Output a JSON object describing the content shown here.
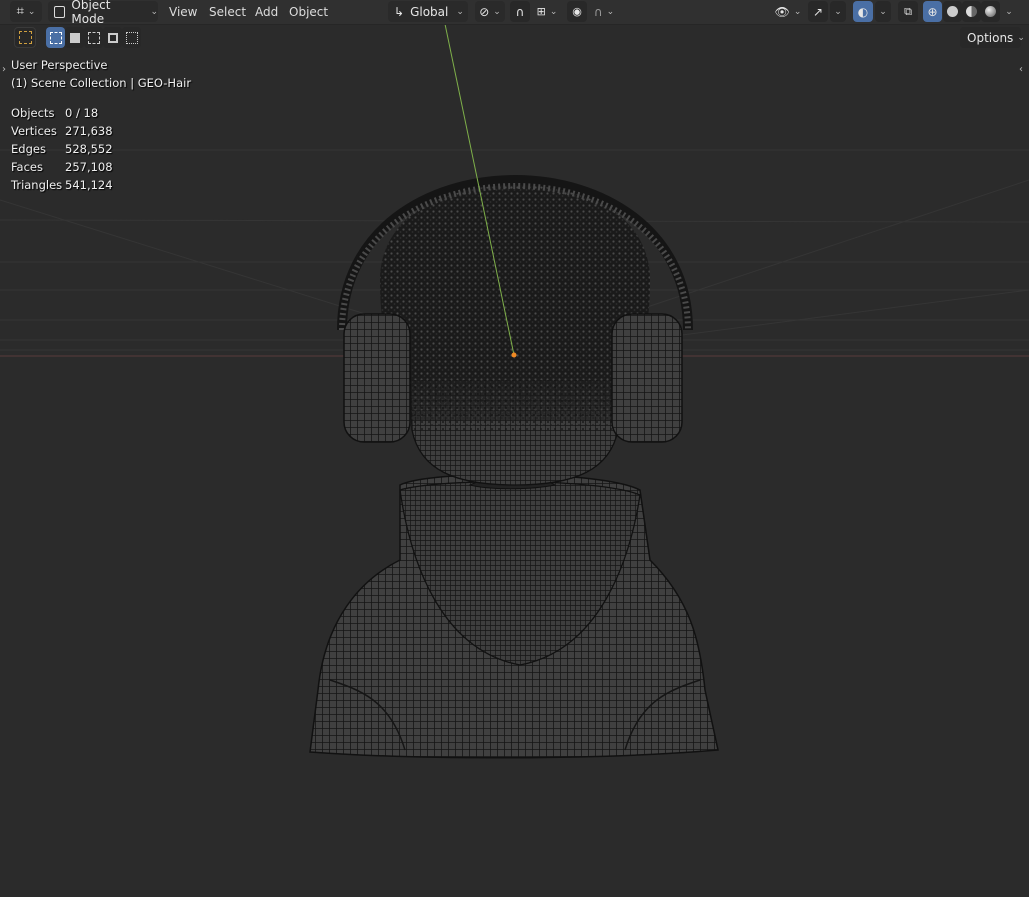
{
  "header": {
    "editor_type_icon": "transform-axes-icon",
    "mode_label": "Object Mode",
    "menus": [
      "View",
      "Select",
      "Add",
      "Object"
    ],
    "orientation_label": "Global",
    "options_label": "Options"
  },
  "overlay": {
    "view_name": "User Perspective",
    "collection": "(1) Scene Collection | GEO-Hair"
  },
  "stats": [
    {
      "label": "Objects",
      "value": "0 / 18"
    },
    {
      "label": "Vertices",
      "value": "271,638"
    },
    {
      "label": "Edges",
      "value": "528,552"
    },
    {
      "label": "Faces",
      "value": "257,108"
    },
    {
      "label": "Triangles",
      "value": "541,124"
    }
  ],
  "colors": {
    "header_bg": "#303030",
    "viewport_bg": "#2b2b2b",
    "wire": "#0c0c0c",
    "selected_button": "#4a6fa5",
    "origin_dot": "#f08a24",
    "y_axis_line": "#7fb04a"
  }
}
